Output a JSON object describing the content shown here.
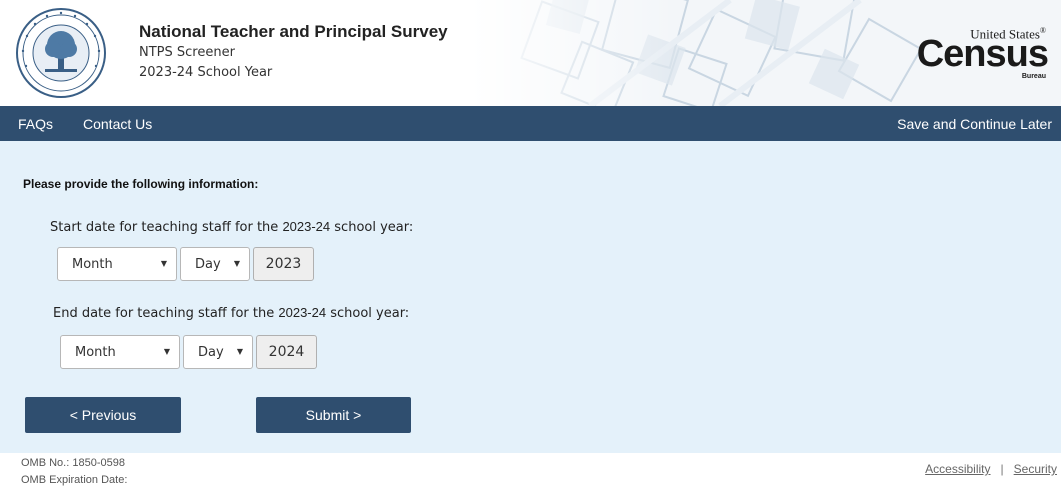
{
  "header": {
    "title": "National Teacher and Principal Survey",
    "subtitle": "NTPS Screener",
    "school_year": "2023-24 School Year",
    "seal_icon": "department-of-education-seal",
    "logo": {
      "small": "United States",
      "registered": "®",
      "big": "Census",
      "bureau": "Bureau"
    }
  },
  "nav": {
    "faqs": "FAQs",
    "contact": "Contact Us",
    "save": "Save and Continue Later"
  },
  "form": {
    "instruction": "Please provide the following information:",
    "start": {
      "label_prefix": "Start date for teaching staff for the ",
      "label_year": "2023-24",
      "label_suffix": " school year:",
      "month": "Month",
      "day": "Day",
      "year": "2023"
    },
    "end": {
      "label_prefix": "End date for teaching staff for the ",
      "label_year": "2023-24",
      "label_suffix": " school year:",
      "month": "Month",
      "day": "Day",
      "year": "2024"
    },
    "dropdown_caret": "▼"
  },
  "buttons": {
    "previous": "< Previous",
    "submit": "Submit >"
  },
  "footer": {
    "omb_no": "OMB No.: 1850-0598",
    "omb_exp": "OMB Expiration Date:",
    "accessibility": "Accessibility",
    "separator": "|",
    "security": "Security"
  },
  "colors": {
    "nav_bg": "#2f4e6f",
    "panel_bg": "#e4f1fa",
    "button_bg": "#2f4e6f"
  }
}
